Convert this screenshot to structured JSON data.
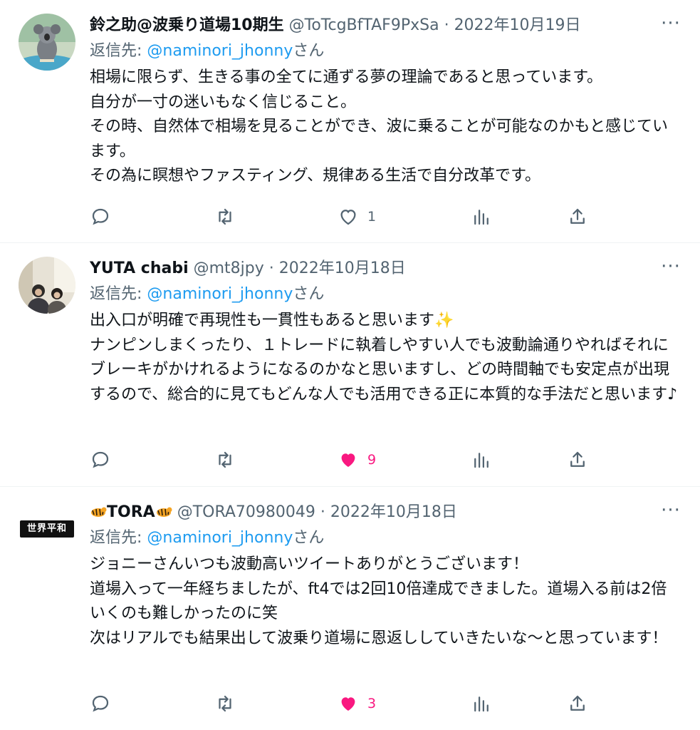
{
  "tweets": [
    {
      "name": "鈴之助@波乗り道場10期生",
      "handle": "@ToTcgBfTAF9PxSa",
      "dot": "·",
      "date": "2022年10月19日",
      "reply_label": "返信先: ",
      "reply_mention": "@naminori_jhonny",
      "reply_suffix": "さん",
      "text": "相場に限らず、生きる事の全てに通ずる夢の理論であると思っています。\n自分が一寸の迷いもなく信じること。\nその時、自然体で相場を見ることができ、波に乗ることが可能なのかもと感じています。\nその為に瞑想やファスティング、規律ある生活で自分改革です。",
      "likes": "1",
      "liked": false
    },
    {
      "name": "YUTA chabi",
      "handle": "@mt8jpy",
      "dot": "·",
      "date": "2022年10月18日",
      "reply_label": "返信先: ",
      "reply_mention": "@naminori_jhonny",
      "reply_suffix": "さん",
      "text": "出入口が明確で再現性も一貫性もあると思います✨\nナンピンしまくったり、１トレードに執着しやすい人でも波動論通りやればそれにブレーキがかけれるようになるのかなと思いますし、どの時間軸でも安定点が出現するので、総合的に見てもどんな人でも活用できる正に本質的な手法だと思います♪",
      "likes": "9",
      "liked": true
    },
    {
      "name": "TORA",
      "handle": "@TORA70980049",
      "dot": "·",
      "date": "2022年10月18日",
      "reply_label": "返信先: ",
      "reply_mention": "@naminori_jhonny",
      "reply_suffix": "さん",
      "text": "ジョニーさんいつも波動高いツイートありがとうございます！\n道場入って一年経ちましたが、ft4では2回10倍達成できました。道場入る前は2倍いくのも難しかったのに笑\n次はリアルでも結果出して波乗り道場に恩返ししていきたいな〜と思っています！",
      "likes": "3",
      "liked": true,
      "avatar_text": "世界平和"
    }
  ],
  "more_label": "···",
  "colors": {
    "accent": "#1d9bf0",
    "like": "#f91880",
    "secondary": "#536471"
  },
  "icons": [
    "reply-icon",
    "retweet-icon",
    "like-icon",
    "views-icon",
    "share-icon",
    "more-icon"
  ]
}
